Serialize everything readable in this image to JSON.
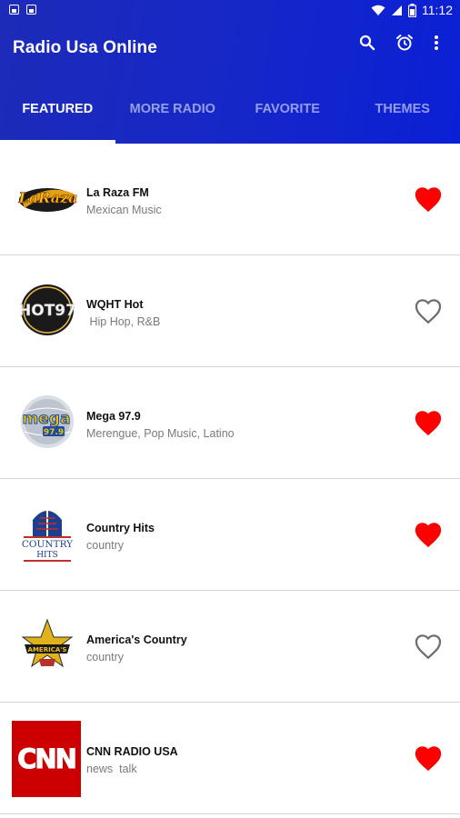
{
  "status_bar": {
    "time": "11:12",
    "left_icons": [
      "image-icon",
      "image-icon"
    ],
    "right_icons": [
      "wifi-icon",
      "signal-icon",
      "battery-icon"
    ]
  },
  "app": {
    "title": "Radio Usa Online",
    "actions": [
      "search-icon",
      "alarm-icon",
      "more-vert-icon"
    ]
  },
  "tabs": [
    {
      "label": "FEATURED",
      "active": true
    },
    {
      "label": "MORE RADIO",
      "active": false
    },
    {
      "label": "FAVORITE",
      "active": false
    },
    {
      "label": "THEMES",
      "active": false
    }
  ],
  "stations": [
    {
      "name": "La Raza FM",
      "genre": "Mexican Music",
      "favorite": true,
      "logo": "la-raza-logo"
    },
    {
      "name": "WQHT Hot",
      "genre": " Hip Hop, R&B",
      "favorite": false,
      "logo": "hot97-logo"
    },
    {
      "name": "Mega 97.9",
      "genre": "Merengue, Pop Music, Latino",
      "favorite": true,
      "logo": "mega979-logo"
    },
    {
      "name": "Country Hits",
      "genre": "country",
      "favorite": true,
      "logo": "country-hits-logo"
    },
    {
      "name": "America's Country",
      "genre": "country",
      "favorite": false,
      "logo": "americas-country-logo"
    },
    {
      "name": "CNN RADIO USA",
      "genre": "news  talk",
      "favorite": true,
      "logo": "cnn-logo"
    }
  ],
  "logo_text": {
    "la_raza": "LaRaza",
    "hot97": "HOT97",
    "mega": "mega",
    "mega_freq": "97.9",
    "country_hits_1": "COUNTRY",
    "country_hits_2": "HITS",
    "americas_country": "AMERICA'S",
    "cnn": "CNN"
  },
  "colors": {
    "appbar": "#1527c9",
    "favorite_on": "#ff0000",
    "favorite_off": "#6e6e6e",
    "cnn_red": "#cc0000"
  }
}
